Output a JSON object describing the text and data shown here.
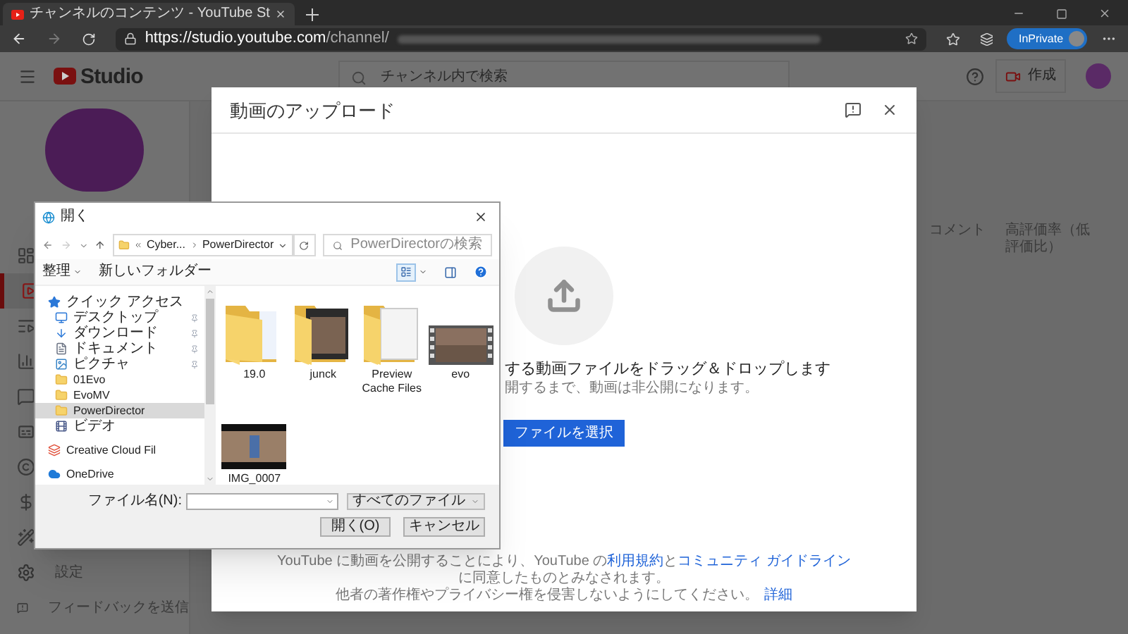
{
  "browser": {
    "tab_title": "チャンネルのコンテンツ - YouTube St",
    "url_host": "https://studio.youtube.com",
    "url_path": "/channel/",
    "inprivate_label": "InPrivate"
  },
  "studio_header": {
    "logo_text": "Studio",
    "search_placeholder": "チャンネル内で検索",
    "create_label": "作成"
  },
  "sidebar": {
    "items": [
      {
        "kind": "dashboard",
        "selected": false
      },
      {
        "kind": "content",
        "selected": true
      },
      {
        "kind": "playlists",
        "selected": false
      },
      {
        "kind": "analytics",
        "selected": false
      },
      {
        "kind": "comments",
        "selected": false
      },
      {
        "kind": "subtitles",
        "selected": false
      },
      {
        "kind": "copyright",
        "selected": false
      },
      {
        "kind": "earn",
        "selected": false
      },
      {
        "kind": "customize",
        "selected": false
      }
    ],
    "settings_label": "設定",
    "feedback_label": "フィードバックを送信"
  },
  "table_header": {
    "columns": [
      "コメント",
      "高評価率（低評価比）"
    ]
  },
  "upload_modal": {
    "title": "動画のアップロード",
    "drop_text": "する動画ファイルをドラッグ＆ドロップします",
    "privacy_note": "開するまで、動画は非公開になります。",
    "select_button": "ファイルを選択",
    "terms_start": "YouTube に動画を公開することにより、YouTube の",
    "terms_link": "利用規約",
    "terms_and": "と",
    "guidelines_link": "コミュニティ ガイドライン",
    "terms_end": "に同意したものとみなされます。",
    "copyright_text": "他者の著作権やプライバシー権を侵害しないようにしてください。",
    "details_link": "詳細"
  },
  "file_dialog": {
    "title": "開く",
    "breadcrumb": [
      "Cyber...",
      "PowerDirector"
    ],
    "search_placeholder": "PowerDirectorの検索",
    "toolbar": {
      "organize": "整理",
      "new_folder": "新しいフォルダー"
    },
    "nav": [
      {
        "label": "クイック アクセス",
        "kind": "star",
        "selected": false,
        "pinned": false,
        "children": [
          {
            "label": "デスクトップ",
            "kind": "desktop",
            "selected": false,
            "pinned": true
          },
          {
            "label": "ダウンロード",
            "kind": "download",
            "selected": false,
            "pinned": true
          },
          {
            "label": "ドキュメント",
            "kind": "document",
            "selected": false,
            "pinned": true
          },
          {
            "label": "ピクチャ",
            "kind": "picture",
            "selected": false,
            "pinned": true
          },
          {
            "label": "01Evo",
            "kind": "folder",
            "selected": false,
            "pinned": false
          },
          {
            "label": "EvoMV",
            "kind": "folder",
            "selected": false,
            "pinned": false
          },
          {
            "label": "PowerDirector",
            "kind": "folder",
            "selected": true,
            "pinned": false
          },
          {
            "label": "ビデオ",
            "kind": "video",
            "selected": false,
            "pinned": false
          }
        ]
      },
      {
        "label": "Creative Cloud Fil",
        "kind": "cloud-app",
        "selected": false,
        "pinned": false
      },
      {
        "label": "OneDrive",
        "kind": "cloud",
        "selected": false,
        "pinned": false
      }
    ],
    "files": [
      {
        "name": "19.0",
        "kind": "folder"
      },
      {
        "name": "junck",
        "kind": "photo-folder"
      },
      {
        "name": "Preview Cache Files",
        "kind": "paper-folder"
      },
      {
        "name": "evo",
        "kind": "film"
      },
      {
        "name": "IMG_0007",
        "kind": "video"
      }
    ],
    "filename_label": "ファイル名(N):",
    "file_type": "すべてのファイル",
    "open_button": "開く(O)",
    "cancel_button": "キャンセル"
  }
}
